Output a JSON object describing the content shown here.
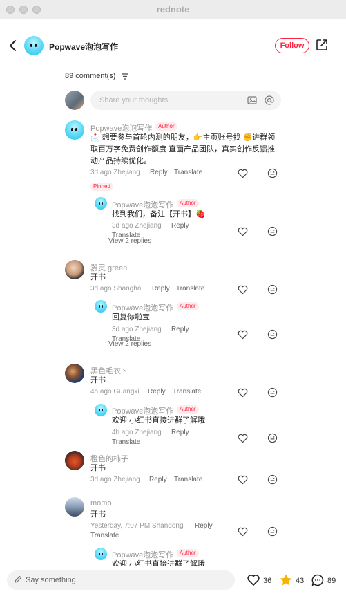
{
  "window": {
    "title": "rednote"
  },
  "header": {
    "author_name": "Popwave泡泡写作",
    "follow_label": "Follow"
  },
  "comments_header": {
    "count_label": "89 comment(s)"
  },
  "composer": {
    "placeholder": "Share your thoughts..."
  },
  "labels": {
    "author": "Author",
    "pinned": "Pinned",
    "reply": "Reply",
    "translate": "Translate",
    "view_replies": "View 2 replies"
  },
  "comments": [
    {
      "user": "Popwave泡泡写作",
      "text_line1": "📩 想要参与首轮内测的朋友，👉主页账号找 ✊进群领",
      "text_line2": "取百万字免费创作额度 直面产品团队，真实创作反馈推",
      "text_line3": "动产品持续优化。",
      "meta": "3d ago Zhejiang",
      "reply": {
        "user": "Popwave泡泡写作",
        "text": "找到我们，备注【开书】🍓",
        "meta": "3d ago Zhejiang"
      }
    },
    {
      "user": "嚣灵 green",
      "text": "开书",
      "meta": "3d ago Shanghai",
      "reply": {
        "user": "Popwave泡泡写作",
        "text": "回复你啦宝",
        "meta": "3d ago Zhejiang"
      }
    },
    {
      "user": "黑色毛衣丶",
      "text": "开书",
      "meta": "4h ago Guangxi",
      "reply": {
        "user": "Popwave泡泡写作",
        "text": "欢迎 小红书直接进群了解哦",
        "meta": "4h ago Zhejiang"
      }
    },
    {
      "user": "橙色的柿子",
      "text": "开书",
      "meta": "3d ago Zhejiang"
    },
    {
      "user": "momo",
      "text": "开书",
      "meta": "Yesterday, 7:07 PM Shandong",
      "reply": {
        "user": "Popwave泡泡写作",
        "text": "欢迎 小红书直接进群了解哦"
      }
    }
  ],
  "bottom": {
    "placeholder": "Say something...",
    "likes": "36",
    "stars": "43",
    "comments": "89"
  },
  "colors": {
    "accent": "#ff2442",
    "muted": "#999999",
    "star": "#f5b400"
  },
  "icons": [
    "back-arrow-icon",
    "share-icon",
    "sort-icon",
    "image-icon",
    "at-icon",
    "heart-icon",
    "emoji-icon",
    "pencil-icon",
    "star-icon",
    "comment-bubble-icon"
  ]
}
